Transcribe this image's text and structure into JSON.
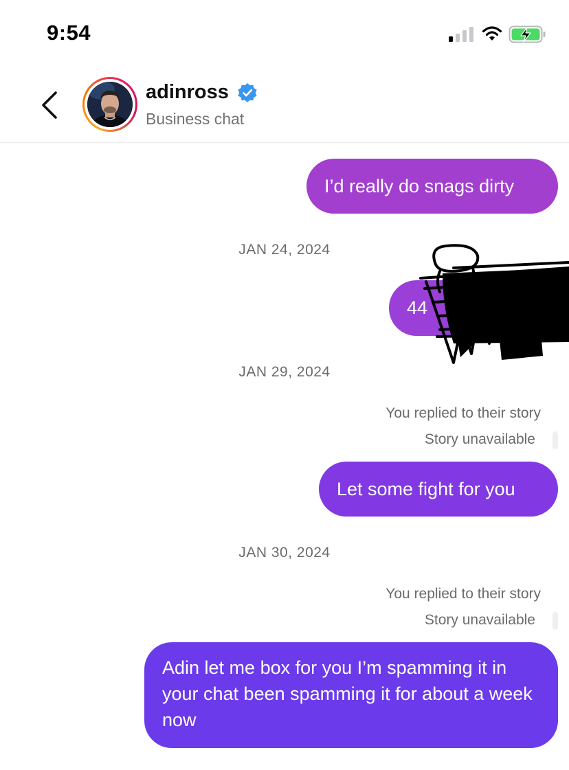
{
  "status_bar": {
    "time": "9:54",
    "signal_icon": "cellular-signal-icon",
    "wifi_icon": "wifi-icon",
    "battery_icon": "battery-charging-icon",
    "battery_color": "#4cd964"
  },
  "header": {
    "username": "adinross",
    "subtitle": "Business chat",
    "back_icon": "chevron-left-icon",
    "verified_icon": "verified-badge-icon",
    "verified_color": "#3897f0",
    "avatar_ring_colors": [
      "#f9a825",
      "#e91e63"
    ]
  },
  "messages": {
    "msg1": "I’d really do snags dirty",
    "date1": "JAN 24, 2024",
    "msg2_visible": "44",
    "date2": "JAN 29, 2024",
    "reply_note1": "You replied to their story",
    "story_note1": "Story unavailable",
    "msg3": "Let some fight for you",
    "date3": "JAN 30, 2024",
    "reply_note2": "You replied to their story",
    "story_note2": "Story unavailable",
    "msg4": "Adin let me box for you I’m spamming it in your chat been spamming it for about a week now"
  },
  "colors": {
    "bubble_1": "#a23fcf",
    "bubble_2": "#9a3fd8",
    "bubble_3": "#8238e2",
    "bubble_4": "#6b3aea",
    "redaction": "#000000"
  }
}
